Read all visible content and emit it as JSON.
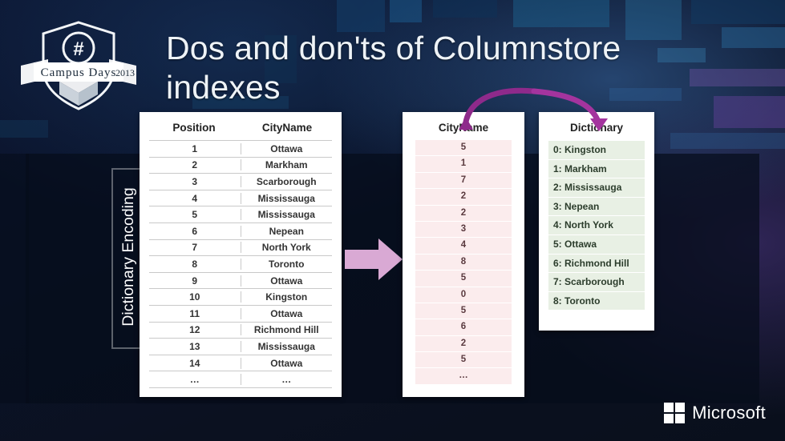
{
  "slide": {
    "title": "Dos and don'ts of Columnstore indexes",
    "vertical_label": "Dictionary Encoding",
    "logo": {
      "brand": "Campus Days",
      "year": "2013",
      "hash": "#"
    },
    "footer_logo": {
      "name": "Microsoft"
    }
  },
  "table_position": {
    "headers": [
      "Position",
      "CityName"
    ],
    "rows": [
      [
        "1",
        "Ottawa"
      ],
      [
        "2",
        "Markham"
      ],
      [
        "3",
        "Scarborough"
      ],
      [
        "4",
        "Mississauga"
      ],
      [
        "5",
        "Mississauga"
      ],
      [
        "6",
        "Nepean"
      ],
      [
        "7",
        "North York"
      ],
      [
        "8",
        "Toronto"
      ],
      [
        "9",
        "Ottawa"
      ],
      [
        "10",
        "Kingston"
      ],
      [
        "11",
        "Ottawa"
      ],
      [
        "12",
        "Richmond Hill"
      ],
      [
        "13",
        "Mississauga"
      ],
      [
        "14",
        "Ottawa"
      ],
      [
        "…",
        "…"
      ]
    ]
  },
  "table_encoded": {
    "header": "CityName",
    "values": [
      "5",
      "1",
      "7",
      "2",
      "2",
      "3",
      "4",
      "8",
      "5",
      "0",
      "5",
      "6",
      "2",
      "5",
      "…"
    ]
  },
  "dictionary": {
    "header": "Dictionary",
    "entries": [
      "0: Kingston",
      "1: Markham",
      "2: Mississauga",
      "3: Nepean",
      "4: North York",
      "5: Ottawa",
      "6: Richmond Hill",
      "7: Scarborough",
      "8: Toronto"
    ]
  },
  "colors": {
    "encoded_cell": "#fbeced",
    "dictionary_cell": "#e8f0e4",
    "arrow": "#d9a9d4",
    "curve_arrow": "#8e2a8b",
    "background": "#0b1530"
  },
  "icons": {
    "big_arrow": "right-arrow-icon",
    "curve_left": "curved-arrow-icon",
    "curve_right": "curved-arrow-icon"
  }
}
